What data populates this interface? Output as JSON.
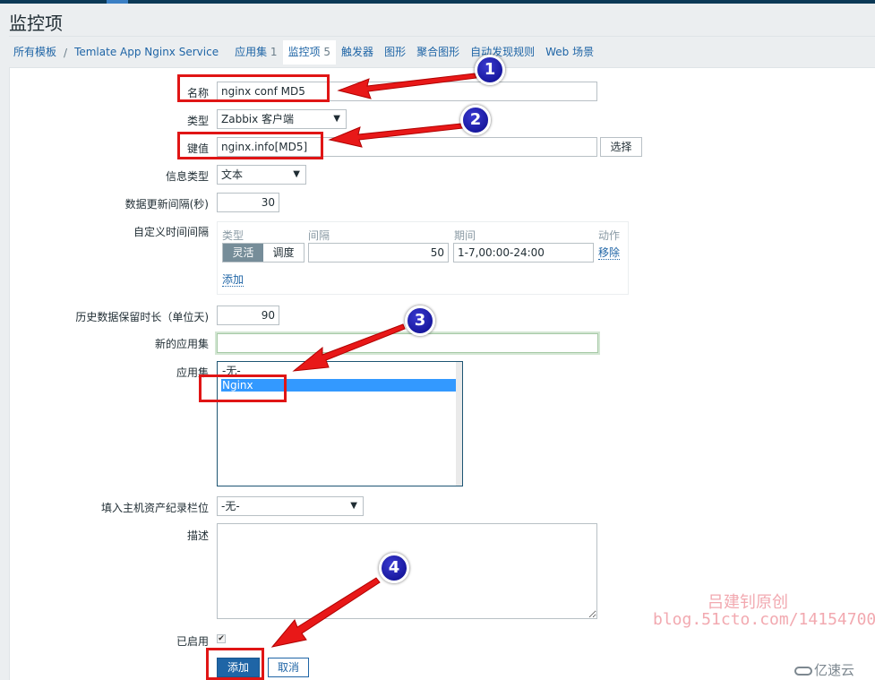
{
  "page": {
    "title": "监控项"
  },
  "breadcrumb": {
    "all_templates": "所有模板",
    "separator": "/",
    "template": "Temlate App Nginx Service"
  },
  "tabs": [
    {
      "label": "应用集",
      "count": "1",
      "active": false
    },
    {
      "label": "监控项",
      "count": "5",
      "active": true
    },
    {
      "label": "触发器",
      "count": "",
      "active": false
    },
    {
      "label": "图形",
      "count": "",
      "active": false
    },
    {
      "label": "聚合图形",
      "count": "",
      "active": false
    },
    {
      "label": "自动发现规则",
      "count": "",
      "active": false
    },
    {
      "label": "Web 场景",
      "count": "",
      "active": false
    }
  ],
  "form": {
    "name": {
      "label": "名称",
      "value": "nginx conf MD5"
    },
    "type": {
      "label": "类型",
      "value": "Zabbix 客户端"
    },
    "key": {
      "label": "键值",
      "value": "nginx.info[MD5]",
      "select_button": "选择"
    },
    "info_type": {
      "label": "信息类型",
      "value": "文本"
    },
    "update_interval": {
      "label": "数据更新间隔(秒)",
      "value": "30"
    },
    "custom_intervals": {
      "label": "自定义时间间隔",
      "headers": {
        "type": "类型",
        "interval": "间隔",
        "period": "期间",
        "action": "动作"
      },
      "rows": [
        {
          "mode_options": [
            "灵活",
            "调度"
          ],
          "selected_mode": "灵活",
          "interval": "50",
          "period": "1-7,00:00-24:00",
          "remove": "移除"
        }
      ],
      "add": "添加"
    },
    "history": {
      "label": "历史数据保留时长（单位天)",
      "value": "90"
    },
    "new_application": {
      "label": "新的应用集",
      "value": ""
    },
    "applications": {
      "label": "应用集",
      "options": [
        "-无-",
        "Nginx"
      ],
      "selected": "Nginx"
    },
    "inventory": {
      "label": "填入主机资产纪录栏位",
      "value": "-无-"
    },
    "description": {
      "label": "描述",
      "value": ""
    },
    "enabled": {
      "label": "已启用",
      "checked": true,
      "check_glyph": "✔"
    },
    "add_button": "添加",
    "cancel_button": "取消"
  },
  "annotations": {
    "badges": [
      "1",
      "2",
      "3",
      "4"
    ],
    "colors": {
      "highlight": "#e01515",
      "badge": "#0a0a8a",
      "accent": "#1f65a6"
    }
  },
  "watermarks": {
    "author": "吕建钊原创",
    "blog": "blog.51cto.com/14154700",
    "brand": "亿速云"
  },
  "icons": {
    "dropdown_arrow": "▼",
    "brand_logo": "cloud-icon"
  }
}
